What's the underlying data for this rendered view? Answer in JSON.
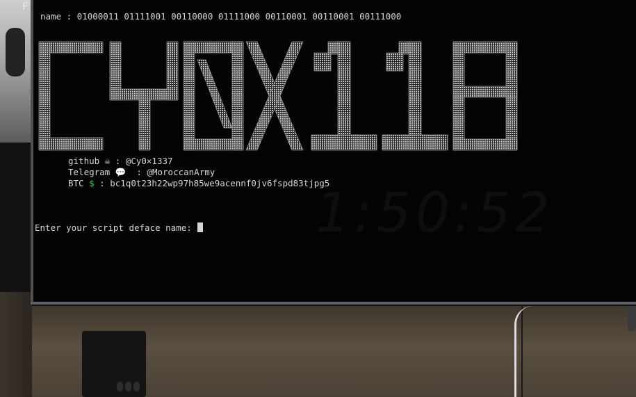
{
  "desktop": {
    "label": "F"
  },
  "terminal": {
    "name_line": "name : 01000011 01111001 00110000 01111000 00110001 00110001 00111000",
    "banner_text": "CY0X118",
    "github": {
      "label": "github",
      "icon": "skull-icon",
      "glyph": "☠",
      "sep": " : ",
      "value": "@Cy0×1337"
    },
    "telegram": {
      "label": "Telegram",
      "icon": "speech-bubble-icon",
      "glyph": "💬",
      "sep": "  : ",
      "value": "@MoroccanArmy"
    },
    "btc": {
      "label": "BTC",
      "icon": "dollar-icon",
      "glyph": "$",
      "sep": " : ",
      "value": "bc1q0t23h22wp97h85we9acennf0jv6fspd83tjpg5"
    },
    "prompt": "Enter your script deface name: ",
    "clock": "1:50:52"
  },
  "colors": {
    "accent_dollar": "#3ccf4e",
    "text": "#d6d6d6",
    "background": "#030304"
  }
}
